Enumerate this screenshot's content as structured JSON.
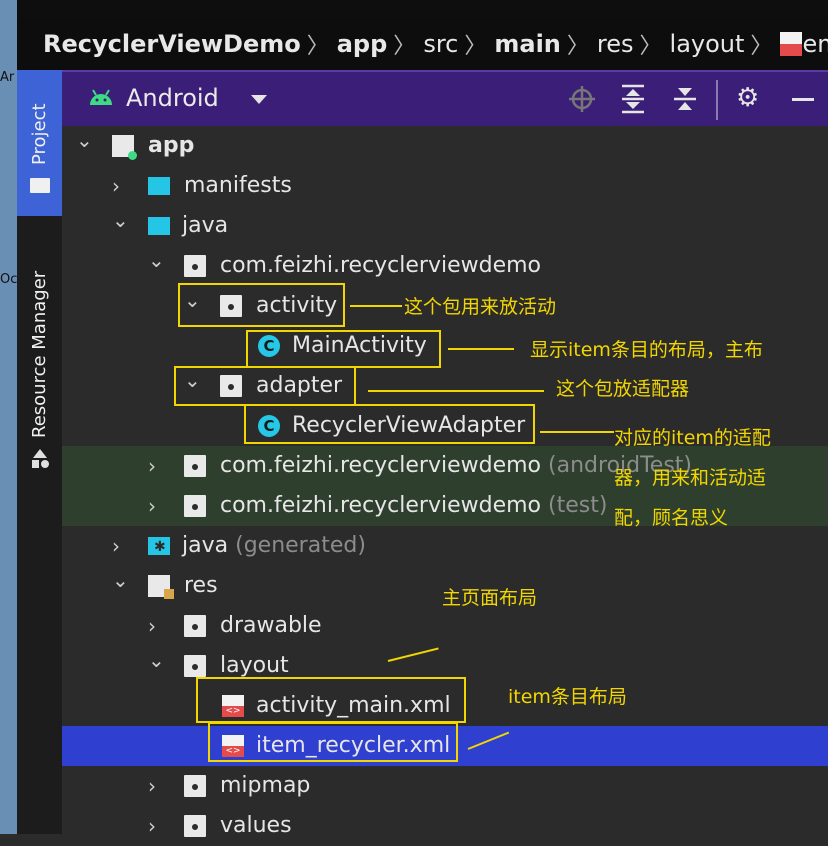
{
  "breadcrumb": [
    {
      "label": "RecyclerViewDemo",
      "bold": true
    },
    {
      "label": "app",
      "bold": true
    },
    {
      "label": "src",
      "bold": false
    },
    {
      "label": "main",
      "bold": true
    },
    {
      "label": "res",
      "bold": false
    },
    {
      "label": "layout",
      "bold": false
    },
    {
      "label": "item_re",
      "bold": false
    }
  ],
  "separator": "〉",
  "desktop": {
    "label1": "Ar",
    "label2": "Oc"
  },
  "side_panel": {
    "project": "Project",
    "resource_manager": "Resource Manager"
  },
  "toolbar": {
    "view_label": "Android"
  },
  "icons": {
    "android": "android-icon",
    "dropdown": "chevron-down-icon",
    "locate": "crosshair-icon",
    "expand": "expand-all-icon",
    "collapse": "collapse-all-icon",
    "settings": "gear-icon",
    "hide": "minus-icon"
  },
  "tree": [
    {
      "name": "app",
      "chev": "⌄",
      "icon": "module"
    },
    {
      "name": "manifests",
      "chev": "›",
      "icon": "folder-cyan"
    },
    {
      "name": "java",
      "chev": "⌄",
      "icon": "folder-cyan"
    },
    {
      "name": "com.feizhi.recyclerviewdemo",
      "chev": "⌄",
      "icon": "pkg"
    },
    {
      "name": "activity",
      "chev": "⌄",
      "icon": "pkg"
    },
    {
      "name": "MainActivity",
      "chev": "",
      "icon": "class"
    },
    {
      "name": "adapter",
      "chev": "⌄",
      "icon": "pkg"
    },
    {
      "name": "RecyclerViewAdapter",
      "chev": "",
      "icon": "class"
    },
    {
      "name": "com.feizhi.recyclerviewdemo",
      "suffix": "(androidTest)",
      "chev": "›",
      "icon": "pkg"
    },
    {
      "name": "com.feizhi.recyclerviewdemo",
      "suffix": "(test)",
      "chev": "›",
      "icon": "pkg"
    },
    {
      "name": "java",
      "suffix": "(generated)",
      "chev": "›",
      "icon": "folder-gen"
    },
    {
      "name": "res",
      "chev": "⌄",
      "icon": "res"
    },
    {
      "name": "drawable",
      "chev": "›",
      "icon": "pkg"
    },
    {
      "name": "layout",
      "chev": "⌄",
      "icon": "pkg"
    },
    {
      "name": "activity_main.xml",
      "chev": "",
      "icon": "xml"
    },
    {
      "name": "item_recycler.xml",
      "chev": "",
      "icon": "xml"
    },
    {
      "name": "mipmap",
      "chev": "›",
      "icon": "pkg"
    },
    {
      "name": "values",
      "chev": "›",
      "icon": "pkg"
    }
  ],
  "annotations": {
    "activity_pkg": "这个包用来放活动",
    "main_activity": "显示item条目的布局，主布",
    "adapter_pkg": "这个包放适配器",
    "adapter_line1": "对应的item的适配",
    "adapter_line2": "器，用来和活动适",
    "adapter_line3": "配，顾名思义",
    "main_layout": "主页面布局",
    "item_layout": "item条目布局"
  },
  "colors": {
    "accent": "#3d63d6",
    "toolbar": "#3b1e77",
    "selection": "#2f3fd0",
    "annotation": "#f2d600",
    "test_bg": "#2e3f2e"
  }
}
